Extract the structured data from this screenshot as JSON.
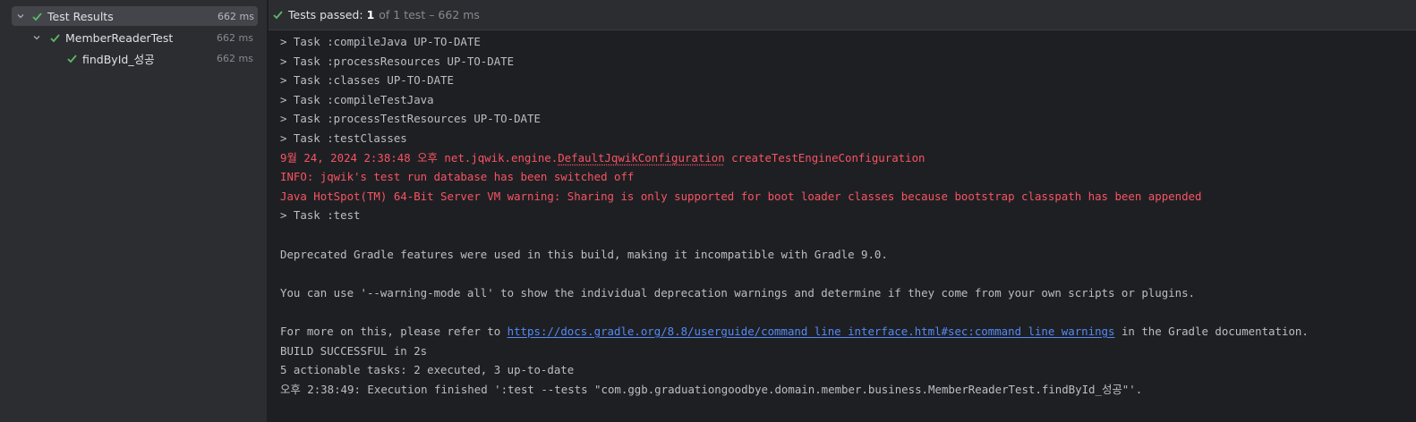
{
  "colors": {
    "success_green": "#5fb865",
    "error_red": "#f75464",
    "link_blue": "#548af7",
    "panel_bg": "#2b2d30",
    "console_bg": "#1e1f22"
  },
  "tree": {
    "root": {
      "label": "Test Results",
      "time": "662 ms",
      "icon": "check-icon",
      "expanded": true
    },
    "suite": {
      "label": "MemberReaderTest",
      "time": "662 ms",
      "icon": "check-icon",
      "expanded": true
    },
    "test": {
      "label": "findById_성공",
      "time": "662 ms",
      "icon": "check-icon"
    }
  },
  "status": {
    "prefix": "Tests passed:",
    "passed": "1",
    "rest": "of 1 test – 662 ms"
  },
  "console": {
    "lines": [
      "> Task :compileJava UP-TO-DATE",
      "> Task :processResources UP-TO-DATE",
      "> Task :classes UP-TO-DATE",
      "> Task :compileTestJava",
      "> Task :processTestResources UP-TO-DATE",
      "> Task :testClasses"
    ],
    "log_prefix": "9월 24, 2024 2:38:48 오후 net.jqwik.engine.",
    "log_class": "DefaultJqwikConfiguration",
    "log_suffix": " createTestEngineConfiguration",
    "info_line": "INFO: jqwik's test run database has been switched off",
    "warning_line": "Java HotSpot(TM) 64-Bit Server VM warning: Sharing is only supported for boot loader classes because bootstrap classpath has been appended",
    "task_test": "> Task :test",
    "deprecated": "Deprecated Gradle features were used in this build, making it incompatible with Gradle 9.0.",
    "warning_mode": "You can use '--warning-mode all' to show the individual deprecation warnings and determine if they come from your own scripts or plugins.",
    "more_prefix": "For more on this, please refer to ",
    "more_link": "https://docs.gradle.org/8.8/userguide/command_line_interface.html#sec:command_line_warnings",
    "more_suffix": " in the Gradle documentation.",
    "build": "BUILD SUCCESSFUL in 2s",
    "tasks": "5 actionable tasks: 2 executed, 3 up-to-date",
    "finished": "오후 2:38:49: Execution finished ':test --tests \"com.ggb.graduationgoodbye.domain.member.business.MemberReaderTest.findById_성공\"'."
  }
}
